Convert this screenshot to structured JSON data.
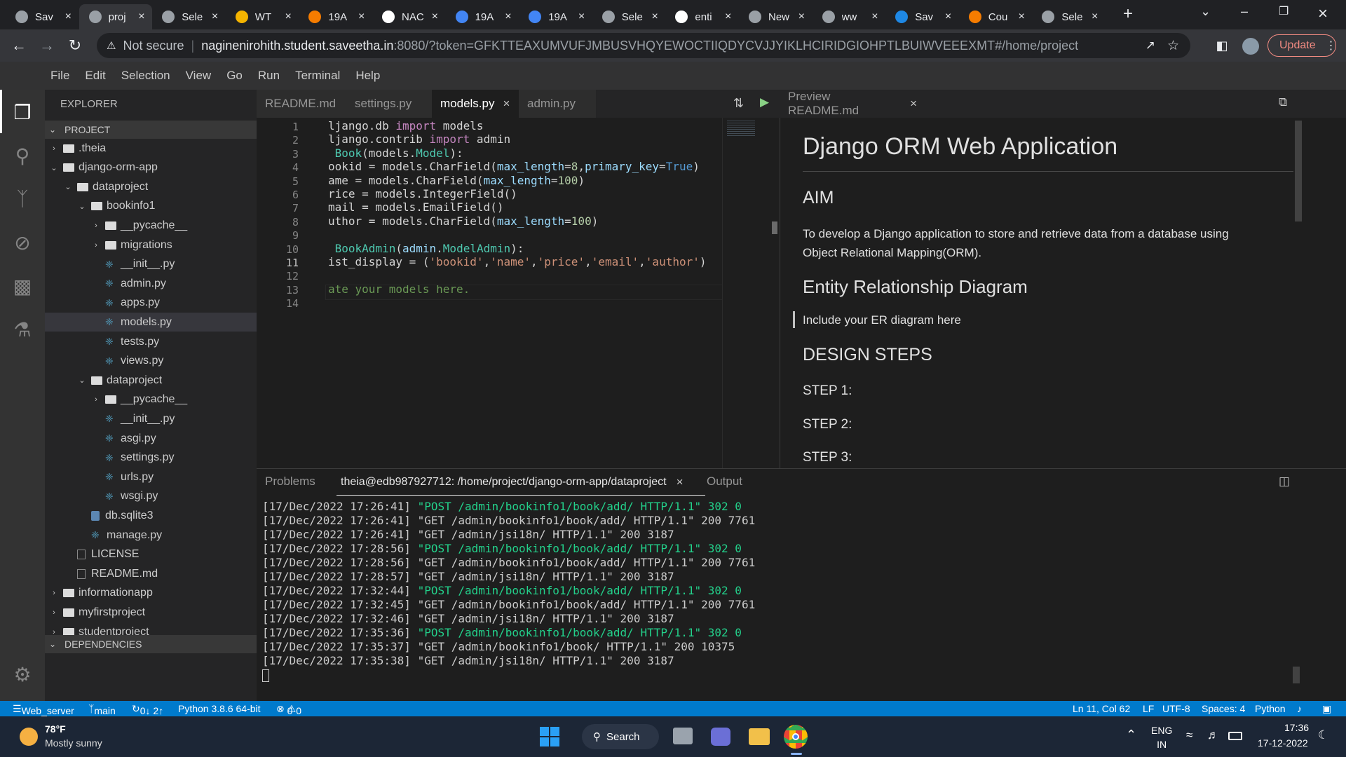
{
  "browser": {
    "tabs": [
      {
        "title": "Sav",
        "active": false
      },
      {
        "title": "proj",
        "active": true
      },
      {
        "title": "Sele",
        "active": false
      },
      {
        "title": "WT",
        "active": false
      },
      {
        "title": "19A",
        "active": false
      },
      {
        "title": "NAC",
        "active": false
      },
      {
        "title": "19A",
        "active": false
      },
      {
        "title": "19A",
        "active": false
      },
      {
        "title": "Sele",
        "active": false
      },
      {
        "title": "enti",
        "active": false
      },
      {
        "title": "New",
        "active": false
      },
      {
        "title": "ww",
        "active": false
      },
      {
        "title": "Sav",
        "active": false
      },
      {
        "title": "Cou",
        "active": false
      },
      {
        "title": "Sele",
        "active": false
      }
    ],
    "not_secure_label": "Not secure",
    "url_host": "naginenirohith.student.saveetha.in",
    "url_rest": ":8080/?token=GFKTTEAXUMVUFJMBUSVHQYEWOCTIIQDYCVJJYIKLHCIRIDGIOHPTLBUIWVEEEXMT#/home/project",
    "update_label": "Update"
  },
  "menu": [
    "File",
    "Edit",
    "Selection",
    "View",
    "Go",
    "Run",
    "Terminal",
    "Help"
  ],
  "explorer": {
    "title": "EXPLORER",
    "section": "PROJECT",
    "items": [
      {
        "label": ".theia",
        "depth": 0,
        "kind": "folder",
        "open": false
      },
      {
        "label": "django-orm-app",
        "depth": 0,
        "kind": "folder",
        "open": true
      },
      {
        "label": "dataproject",
        "depth": 1,
        "kind": "folder",
        "open": true
      },
      {
        "label": "bookinfo1",
        "depth": 2,
        "kind": "folder",
        "open": true
      },
      {
        "label": "__pycache__",
        "depth": 3,
        "kind": "folder",
        "open": false
      },
      {
        "label": "migrations",
        "depth": 3,
        "kind": "folder",
        "open": false
      },
      {
        "label": "__init__.py",
        "depth": 3,
        "kind": "py"
      },
      {
        "label": "admin.py",
        "depth": 3,
        "kind": "py"
      },
      {
        "label": "apps.py",
        "depth": 3,
        "kind": "py"
      },
      {
        "label": "models.py",
        "depth": 3,
        "kind": "py",
        "selected": true
      },
      {
        "label": "tests.py",
        "depth": 3,
        "kind": "py"
      },
      {
        "label": "views.py",
        "depth": 3,
        "kind": "py"
      },
      {
        "label": "dataproject",
        "depth": 2,
        "kind": "folder",
        "open": true
      },
      {
        "label": "__pycache__",
        "depth": 3,
        "kind": "folder",
        "open": false
      },
      {
        "label": "__init__.py",
        "depth": 3,
        "kind": "py"
      },
      {
        "label": "asgi.py",
        "depth": 3,
        "kind": "py"
      },
      {
        "label": "settings.py",
        "depth": 3,
        "kind": "py"
      },
      {
        "label": "urls.py",
        "depth": 3,
        "kind": "py"
      },
      {
        "label": "wsgi.py",
        "depth": 3,
        "kind": "py"
      },
      {
        "label": "db.sqlite3",
        "depth": 2,
        "kind": "db"
      },
      {
        "label": "manage.py",
        "depth": 2,
        "kind": "py"
      },
      {
        "label": "LICENSE",
        "depth": 1,
        "kind": "file"
      },
      {
        "label": "README.md",
        "depth": 1,
        "kind": "file"
      },
      {
        "label": "informationapp",
        "depth": 0,
        "kind": "folder",
        "open": false
      },
      {
        "label": "myfirstproject",
        "depth": 0,
        "kind": "folder",
        "open": false
      },
      {
        "label": "studentproject",
        "depth": 0,
        "kind": "folder",
        "open": false
      }
    ],
    "dependencies": "DEPENDENCIES"
  },
  "editor": {
    "tabs": [
      "README.md",
      "settings.py",
      "models.py",
      "admin.py"
    ],
    "active_tab": "models.py",
    "line_numbers": [
      "1",
      "2",
      "3",
      "4",
      "5",
      "6",
      "7",
      "8",
      "9",
      "10",
      "11",
      "12",
      "13",
      "14"
    ],
    "lines": [
      "ljango.db import models",
      "ljango.contrib import admin",
      " Book(models.Model):",
      "ookid = models.CharField(max_length=8,primary_key=True)",
      "ame = models.CharField(max_length=100)",
      "rice = models.IntegerField()",
      "mail = models.EmailField()",
      "uthor = models.CharField(max_length=100)",
      "",
      " BookAdmin(admin.ModelAdmin):",
      "ist_display = ('bookid','name','price','email','author')",
      "",
      "ate your models here.",
      ""
    ]
  },
  "preview": {
    "tab": "Preview README.md",
    "h1": "Django ORM Web Application",
    "aim_heading": "AIM",
    "aim_text": "To develop a Django application to store and retrieve data from a database using Object Relational Mapping(ORM).",
    "er_heading": "Entity Relationship Diagram",
    "er_text": "Include your ER diagram here",
    "design_heading": "DESIGN STEPS",
    "step1": "STEP 1:",
    "step2": "STEP 2:",
    "step3": "STEP 3:"
  },
  "panel": {
    "tabs": [
      "Problems",
      "theia@edb987927712: /home/project/django-orm-app/dataproject",
      "Output"
    ],
    "terminal_lines": [
      {
        "ts": "[17/Dec/2022 17:26:41]",
        "req": "\"POST /admin/bookinfo1/book/add/ HTTP/1.1\" 302 0",
        "post": true
      },
      {
        "ts": "[17/Dec/2022 17:26:41]",
        "req": "\"GET /admin/bookinfo1/book/add/ HTTP/1.1\" 200 7761",
        "post": false
      },
      {
        "ts": "[17/Dec/2022 17:26:41]",
        "req": "\"GET /admin/jsi18n/ HTTP/1.1\" 200 3187",
        "post": false
      },
      {
        "ts": "[17/Dec/2022 17:28:56]",
        "req": "\"POST /admin/bookinfo1/book/add/ HTTP/1.1\" 302 0",
        "post": true
      },
      {
        "ts": "[17/Dec/2022 17:28:56]",
        "req": "\"GET /admin/bookinfo1/book/add/ HTTP/1.1\" 200 7761",
        "post": false
      },
      {
        "ts": "[17/Dec/2022 17:28:57]",
        "req": "\"GET /admin/jsi18n/ HTTP/1.1\" 200 3187",
        "post": false
      },
      {
        "ts": "[17/Dec/2022 17:32:44]",
        "req": "\"POST /admin/bookinfo1/book/add/ HTTP/1.1\" 302 0",
        "post": true
      },
      {
        "ts": "[17/Dec/2022 17:32:45]",
        "req": "\"GET /admin/bookinfo1/book/add/ HTTP/1.1\" 200 7761",
        "post": false
      },
      {
        "ts": "[17/Dec/2022 17:32:46]",
        "req": "\"GET /admin/jsi18n/ HTTP/1.1\" 200 3187",
        "post": false
      },
      {
        "ts": "[17/Dec/2022 17:35:36]",
        "req": "\"POST /admin/bookinfo1/book/add/ HTTP/1.1\" 302 0",
        "post": true
      },
      {
        "ts": "[17/Dec/2022 17:35:37]",
        "req": "\"GET /admin/bookinfo1/book/ HTTP/1.1\" 200 10375",
        "post": false
      },
      {
        "ts": "[17/Dec/2022 17:35:38]",
        "req": "\"GET /admin/jsi18n/ HTTP/1.1\" 200 3187",
        "post": false
      }
    ]
  },
  "status": {
    "server": "Web_server",
    "branch": "main",
    "sync": "0↓ 2↑",
    "python": "Python 3.8.6 64-bit",
    "errors": "0",
    "warnings": "0",
    "position": "Ln 11, Col 62",
    "eol": "LF",
    "encoding": "UTF-8",
    "spaces": "Spaces: 4",
    "language": "Python"
  },
  "taskbar": {
    "temp": "78°F",
    "weather": "Mostly sunny",
    "search": "Search",
    "lang1": "ENG",
    "lang2": "IN",
    "time": "17:36",
    "date": "17-12-2022"
  },
  "colors": {
    "accent": "#007acc",
    "post_green": "#23d18b"
  }
}
